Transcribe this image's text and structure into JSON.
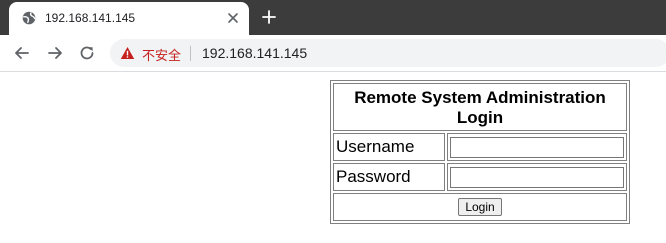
{
  "browser": {
    "tab": {
      "title": "192.168.141.145",
      "favicon": "globe-icon"
    },
    "new_tab_icon": "plus-icon",
    "nav": {
      "back_icon": "arrow-left-icon",
      "forward_icon": "arrow-right-icon",
      "reload_icon": "reload-icon"
    },
    "omnibox": {
      "security_icon": "warning-triangle-icon",
      "security_label": "不安全",
      "security_color": "#c5221f",
      "url": "192.168.141.145"
    },
    "colors": {
      "tabstrip": "#3c3c3c",
      "toolbar": "#ffffff"
    }
  },
  "login_form": {
    "title": "Remote System Administration Login",
    "username_label": "Username",
    "username_value": "",
    "password_label": "Password",
    "password_value": "",
    "submit_label": "Login"
  }
}
